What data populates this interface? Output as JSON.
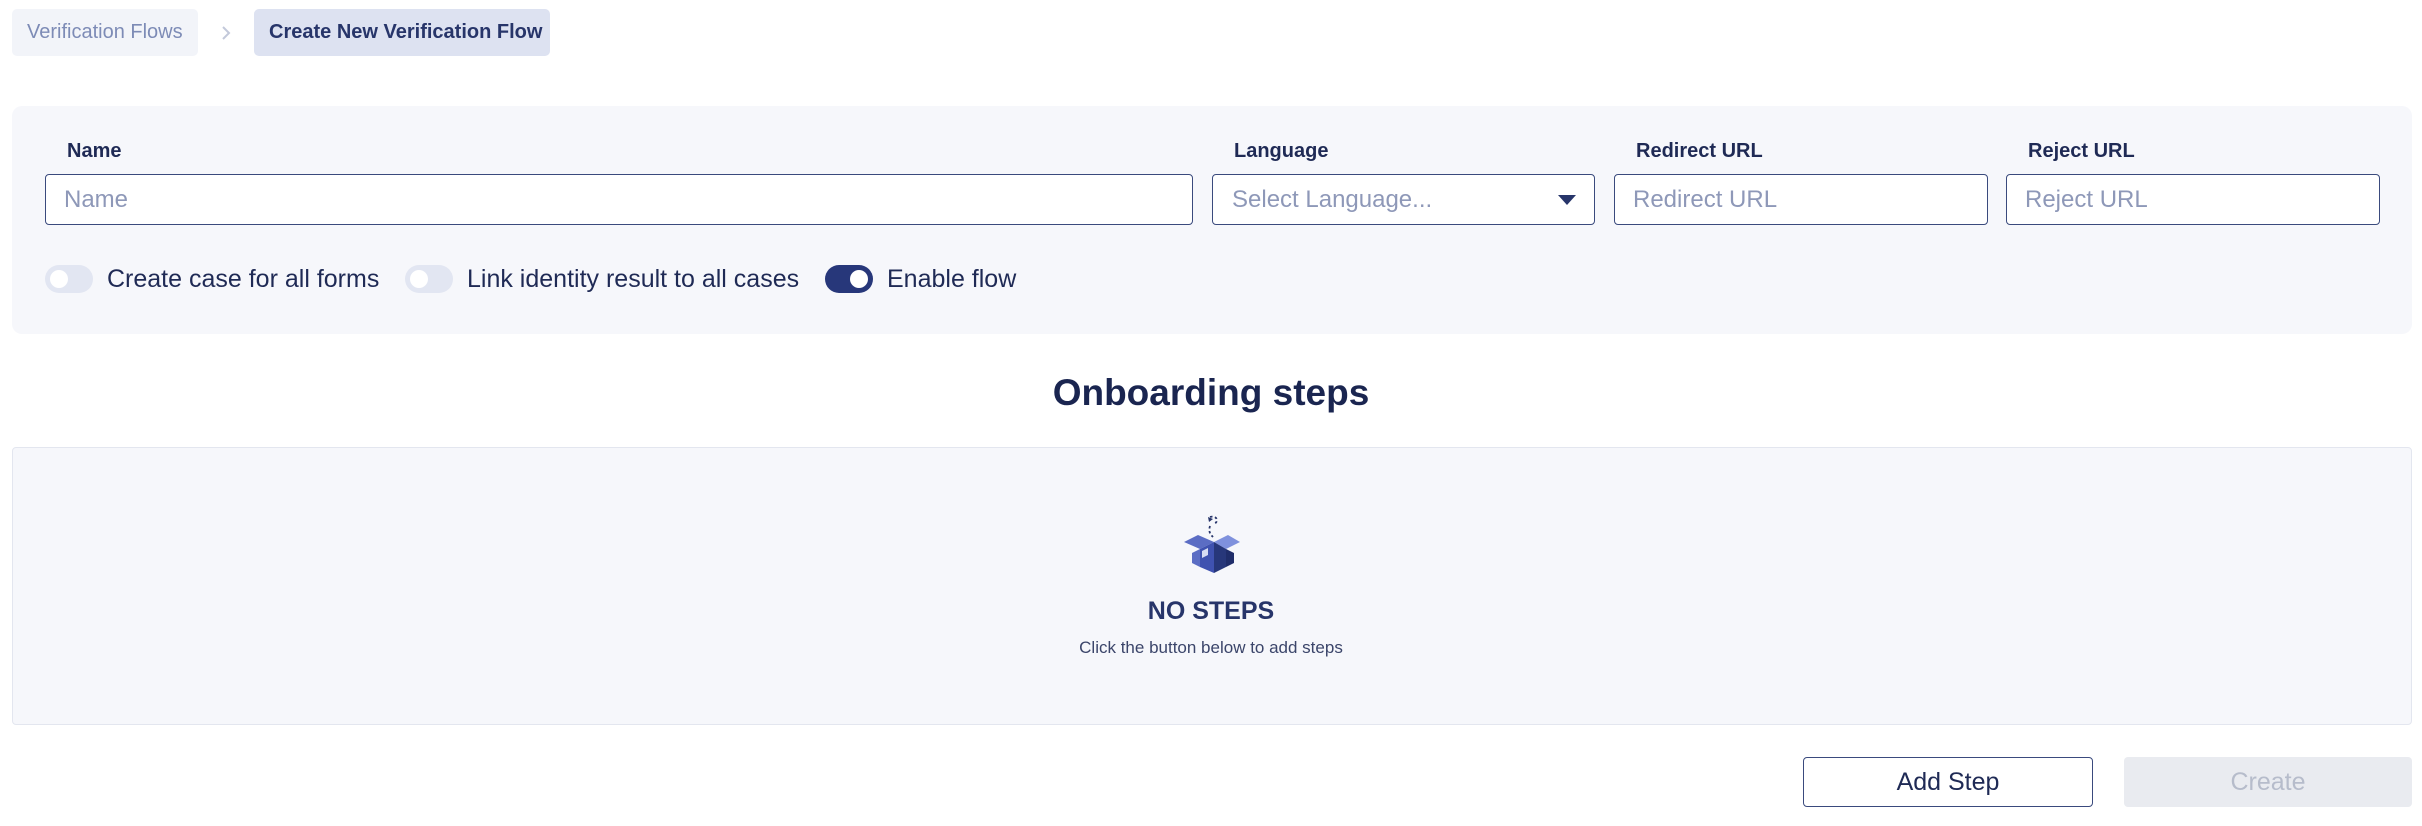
{
  "breadcrumb": {
    "parent": "Verification Flows",
    "current": "Create New Verification Flow"
  },
  "form": {
    "name": {
      "label": "Name",
      "placeholder": "Name",
      "value": ""
    },
    "language": {
      "label": "Language",
      "placeholder": "Select Language..."
    },
    "redirect_url": {
      "label": "Redirect URL",
      "placeholder": "Redirect URL",
      "value": ""
    },
    "reject_url": {
      "label": "Reject URL",
      "placeholder": "Reject URL",
      "value": ""
    }
  },
  "toggles": [
    {
      "label": "Create case for all forms",
      "on": false
    },
    {
      "label": "Link identity result to all cases",
      "on": false
    },
    {
      "label": "Enable flow",
      "on": true
    }
  ],
  "steps": {
    "title": "Onboarding steps",
    "empty_title": "NO STEPS",
    "empty_subtitle": "Click the button below to add steps",
    "icon": "open-box-icon"
  },
  "actions": {
    "add_step": "Add Step",
    "create": "Create",
    "create_enabled": false
  },
  "colors": {
    "primary": "#27377a",
    "text": "#1f2a55",
    "panel_bg": "#f6f7fb",
    "muted": "#8e98b8"
  }
}
